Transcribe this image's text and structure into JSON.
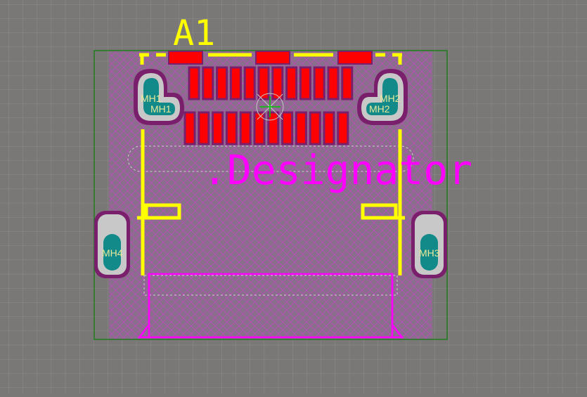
{
  "component": {
    "designator_label": "A1",
    "designator_text": ".Designator"
  },
  "mounting_holes": [
    {
      "id": "mh1",
      "label_a": "MH1",
      "label_b": "MH1"
    },
    {
      "id": "mh2",
      "label_a": "MH2",
      "label_b": "MH2"
    },
    {
      "id": "mh3",
      "label": "MH3"
    },
    {
      "id": "mh4",
      "label": "MH4"
    }
  ],
  "colors": {
    "background": "#7a7877",
    "grid": "#8e8c8b",
    "board_outline": "#1f7a1f",
    "keepout_hatch": "#c040c0",
    "silkscreen_yellow": "#ffff00",
    "courtyard_magenta": "#ff00ff",
    "pad_red": "#ff0000",
    "pad_border": "#7a1f6b",
    "hole_teal": "#138a8a",
    "hole_gray": "#c8c8c8",
    "origin_marker": "#00c800"
  }
}
